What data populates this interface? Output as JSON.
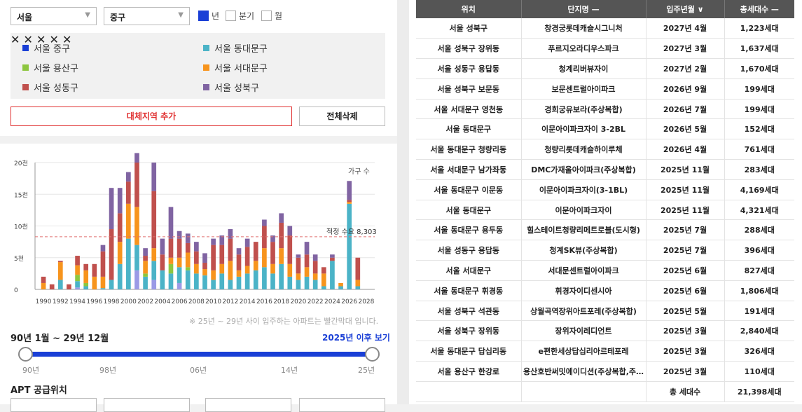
{
  "filters": {
    "city": "서울",
    "district": "중구",
    "period_options": [
      {
        "label": "년",
        "checked": true
      },
      {
        "label": "분기",
        "checked": false
      },
      {
        "label": "월",
        "checked": false
      }
    ]
  },
  "regions": [
    {
      "label": "서울 중구",
      "color": "#1a3fd6",
      "removable": false
    },
    {
      "label": "서울 동대문구",
      "color": "#4bb3c7",
      "removable": true
    },
    {
      "label": "서울 용산구",
      "color": "#8dc63f",
      "removable": true
    },
    {
      "label": "서울 서대문구",
      "color": "#f7941d",
      "removable": true
    },
    {
      "label": "서울 성동구",
      "color": "#c0504d",
      "removable": true
    },
    {
      "label": "서울 성북구",
      "color": "#8064a2",
      "removable": true
    }
  ],
  "buttons": {
    "add_region": "대체지역 추가",
    "delete_all": "전체삭제"
  },
  "chart_data": {
    "type": "bar",
    "stacked": true,
    "legend_label": "가구 수",
    "y_ticks": [
      "0",
      "5천",
      "10천",
      "15천",
      "20천"
    ],
    "ylim": [
      0,
      20000
    ],
    "x_tick_labels": [
      "1990",
      "1992",
      "1994",
      "1996",
      "1998",
      "2000",
      "2002",
      "2004",
      "2006",
      "2008",
      "2010",
      "2012",
      "2014",
      "2016",
      "2018",
      "2020",
      "2022",
      "2024",
      "2026",
      "2028"
    ],
    "reference_line": {
      "label": "적정 수요 8,303",
      "value": 8303
    },
    "categories": [
      "1990",
      "1991",
      "1992",
      "1993",
      "1994",
      "1995",
      "1996",
      "1997",
      "1998",
      "1999",
      "2000",
      "2001",
      "2002",
      "2003",
      "2004",
      "2005",
      "2006",
      "2007",
      "2008",
      "2009",
      "2010",
      "2011",
      "2012",
      "2013",
      "2014",
      "2015",
      "2016",
      "2017",
      "2018",
      "2019",
      "2020",
      "2021",
      "2022",
      "2023",
      "2024",
      "2025",
      "2026",
      "2027"
    ],
    "series": [
      {
        "name": "서울 중구",
        "color": "#9a9ae6",
        "values": [
          0,
          0,
          0,
          0,
          300,
          0,
          0,
          0,
          0,
          0,
          0,
          3000,
          0,
          1500,
          0,
          0,
          1000,
          0,
          0,
          0,
          0,
          0,
          0,
          0,
          0,
          0,
          0,
          0,
          0,
          0,
          0,
          0,
          0,
          0,
          0,
          0,
          0,
          0
        ]
      },
      {
        "name": "서울 동대문구",
        "color": "#4bb3c7",
        "values": [
          0,
          0,
          1500,
          0,
          1000,
          500,
          0,
          200,
          1500,
          4000,
          8000,
          4000,
          2000,
          3000,
          3000,
          2500,
          2500,
          3000,
          2500,
          2200,
          1500,
          2500,
          1500,
          2000,
          2500,
          3000,
          3500,
          2500,
          4000,
          2000,
          1500,
          2000,
          1500,
          500,
          4500,
          500,
          13500,
          500
        ]
      },
      {
        "name": "서울 용산구",
        "color": "#8dc63f",
        "values": [
          0,
          0,
          0,
          0,
          1000,
          500,
          0,
          0,
          0,
          0,
          0,
          0,
          500,
          0,
          0,
          1500,
          0,
          500,
          0,
          0,
          0,
          0,
          0,
          0,
          0,
          0,
          0,
          0,
          0,
          0,
          0,
          0,
          0,
          0,
          0,
          0,
          0,
          0
        ]
      },
      {
        "name": "서울 서대문구",
        "color": "#f7941d",
        "values": [
          1000,
          0,
          2800,
          0,
          1500,
          2000,
          2000,
          1800,
          0,
          3500,
          5500,
          6000,
          2000,
          2000,
          0,
          1000,
          1500,
          2300,
          1500,
          1000,
          1500,
          1500,
          3000,
          1000,
          1200,
          1500,
          3000,
          1500,
          2500,
          2000,
          1000,
          1500,
          1000,
          2000,
          0,
          500,
          300,
          1000
        ]
      },
      {
        "name": "서울 성동구",
        "color": "#c0504d",
        "values": [
          1000,
          800,
          200,
          800,
          1500,
          1000,
          2000,
          4000,
          8000,
          4500,
          3500,
          7000,
          800,
          9000,
          2500,
          3000,
          3000,
          1500,
          2000,
          1000,
          4000,
          3000,
          3500,
          2500,
          3000,
          3000,
          3500,
          3500,
          4000,
          4500,
          2500,
          2000,
          2000,
          1000,
          500,
          0,
          300,
          3500
        ]
      },
      {
        "name": "서울 성북구",
        "color": "#8064a2",
        "values": [
          0,
          0,
          0,
          0,
          0,
          0,
          0,
          1000,
          6500,
          4000,
          1500,
          1500,
          1200,
          4500,
          2500,
          5000,
          1200,
          1500,
          1500,
          1500,
          1000,
          1500,
          1500,
          1000,
          1300,
          0,
          1000,
          1000,
          1500,
          1500,
          500,
          2000,
          1000,
          0,
          500,
          0,
          3000,
          0
        ]
      }
    ]
  },
  "chart_note": "※ 25년 ~ 29년 사이 입주하는 아파트는 빨간막대 입니다.",
  "range_label": "90년 1월 ~ 29년 12월",
  "after_2025_link": "2025년 이후 보기",
  "slider_labels": [
    "90년",
    "98년",
    "06년",
    "14년",
    "25년"
  ],
  "apt_supply_title": "APT 공급위치",
  "table": {
    "headers": [
      "위치",
      "단지명 —",
      "입주년월 ∨",
      "총세대수 —"
    ],
    "rows": [
      [
        "서울 성북구",
        "창경궁롯데캐슬시그니처",
        "2027년 4월",
        "1,223세대"
      ],
      [
        "서울 성북구 장위동",
        "푸르지오라디우스파크",
        "2027년 3월",
        "1,637세대"
      ],
      [
        "서울 성동구 용답동",
        "청계리버뷰자이",
        "2027년 2월",
        "1,670세대"
      ],
      [
        "서울 성북구 보문동",
        "보문센트럴아이파크",
        "2026년 9월",
        "199세대"
      ],
      [
        "서울 서대문구 영천동",
        "경희궁유보라(주상복합)",
        "2026년 7월",
        "199세대"
      ],
      [
        "서울 동대문구",
        "이문아이파크자이 3-2BL",
        "2026년 5월",
        "152세대"
      ],
      [
        "서울 동대문구 청량리동",
        "청량리롯데캐슬하이루체",
        "2026년 4월",
        "761세대"
      ],
      [
        "서울 서대문구 남가좌동",
        "DMC가재울아이파크(주상복합)",
        "2025년 11월",
        "283세대"
      ],
      [
        "서울 동대문구 이문동",
        "이문아이파크자이(3-1BL)",
        "2025년 11월",
        "4,169세대"
      ],
      [
        "서울 동대문구",
        "이문아이파크자이",
        "2025년 11월",
        "4,321세대"
      ],
      [
        "서울 동대문구 용두동",
        "힐스테이트청량리메트로블(도시형)",
        "2025년 7월",
        "288세대"
      ],
      [
        "서울 성동구 용답동",
        "청계SK뷰(주상복합)",
        "2025년 7월",
        "396세대"
      ],
      [
        "서울 서대문구",
        "서대문센트럴아이파크",
        "2025년 6월",
        "827세대"
      ],
      [
        "서울 동대문구 휘경동",
        "휘경자이디센시아",
        "2025년 6월",
        "1,806세대"
      ],
      [
        "서울 성북구 석관동",
        "상월곡역장위아트포레(주상복합)",
        "2025년 5월",
        "191세대"
      ],
      [
        "서울 성북구 장위동",
        "장위자이레디언트",
        "2025년 3월",
        "2,840세대"
      ],
      [
        "서울 동대문구 답십리동",
        "e편한세상답십리아르테포레",
        "2025년 3월",
        "326세대"
      ],
      [
        "서울 용산구 한강로",
        "용산호반써밋에이디션(주상복합,주…",
        "2025년 3월",
        "110세대"
      ]
    ],
    "total_label": "총 세대수",
    "total_value": "21,398세대"
  }
}
